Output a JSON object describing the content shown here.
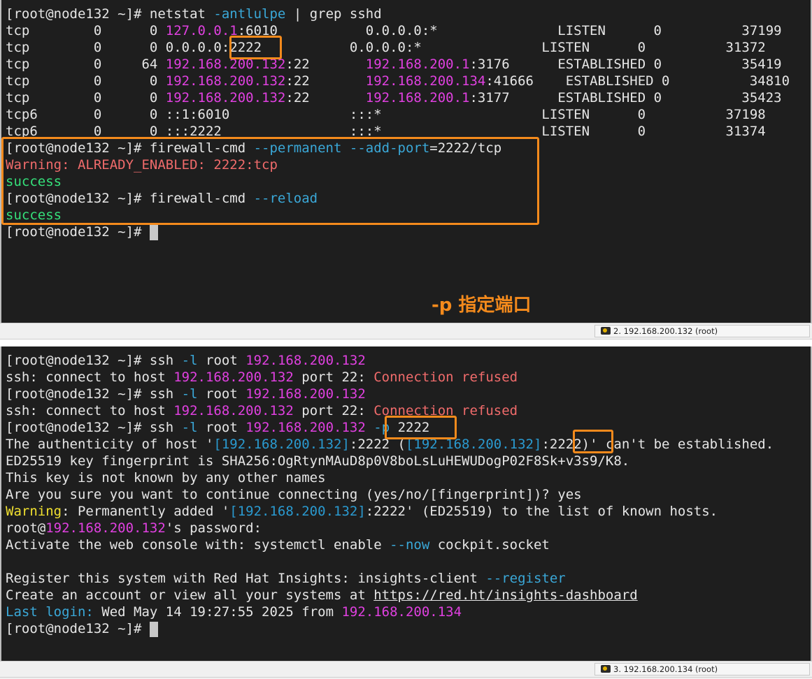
{
  "colors": {
    "background": "#1e1e1e",
    "text": "#e6e6e6",
    "magenta": "#e040e0",
    "cyan": "#3aa8d8",
    "red": "#f06b6b",
    "green": "#35e07a",
    "yellow": "#f0e030",
    "highlight": "#f48a1c"
  },
  "top_terminal": {
    "lines": [
      [
        [
          "white",
          "[root@node132 ~]# netstat "
        ],
        [
          "cyan",
          "-antlulpe"
        ],
        [
          "white",
          " | grep sshd"
        ]
      ],
      [
        [
          "white",
          "tcp        0      0 "
        ],
        [
          "magenta",
          "127.0.0.1"
        ],
        [
          "white",
          ":6010           0.0.0.0:*               LISTEN      0          37199"
        ]
      ],
      [
        [
          "white",
          "tcp        0      0 0.0.0.0:2222           0.0.0.0:*               LISTEN      0          31372"
        ]
      ],
      [
        [
          "white",
          "tcp        0     64 "
        ],
        [
          "magenta",
          "192.168.200.132"
        ],
        [
          "white",
          ":22       "
        ],
        [
          "magenta",
          "192.168.200.1"
        ],
        [
          "white",
          ":3176      ESTABLISHED 0          35419"
        ]
      ],
      [
        [
          "white",
          "tcp        0      0 "
        ],
        [
          "magenta",
          "192.168.200.132"
        ],
        [
          "white",
          ":22       "
        ],
        [
          "magenta",
          "192.168.200.134"
        ],
        [
          "white",
          ":41666    ESTABLISHED 0          34810"
        ]
      ],
      [
        [
          "white",
          "tcp        0      0 "
        ],
        [
          "magenta",
          "192.168.200.132"
        ],
        [
          "white",
          ":22       "
        ],
        [
          "magenta",
          "192.168.200.1"
        ],
        [
          "white",
          ":3177      ESTABLISHED 0          35423"
        ]
      ],
      [
        [
          "white",
          "tcp6       0      0 ::1:6010               :::*                    LISTEN      0          37198"
        ]
      ],
      [
        [
          "white",
          "tcp6       0      0 :::2222                :::*                    LISTEN      0          31374"
        ]
      ],
      [
        [
          "white",
          "[root@node132 ~]# firewall-cmd "
        ],
        [
          "cyan",
          "--permanent --add-port"
        ],
        [
          "white",
          "=2222/tcp"
        ]
      ],
      [
        [
          "red",
          "Warning: ALREADY_ENABLED: 2222:tcp"
        ]
      ],
      [
        [
          "green",
          "success"
        ]
      ],
      [
        [
          "white",
          "[root@node132 ~]# firewall-cmd "
        ],
        [
          "cyan",
          "--reload"
        ]
      ],
      [
        [
          "green",
          "success"
        ]
      ],
      [
        [
          "white",
          "[root@node132 ~]# "
        ]
      ]
    ],
    "annotation": "-p 指定端口",
    "status": "2. 192.168.200.132 (root)"
  },
  "bottom_terminal": {
    "lines": [
      [
        [
          "white",
          "[root@node132 ~]# ssh "
        ],
        [
          "cyan",
          "-l"
        ],
        [
          "white",
          " root "
        ],
        [
          "magenta",
          "192.168.200.132"
        ]
      ],
      [
        [
          "white",
          "ssh: connect to host "
        ],
        [
          "magenta",
          "192.168.200.132"
        ],
        [
          "white",
          " port 22: "
        ],
        [
          "red",
          "Connection refused"
        ]
      ],
      [
        [
          "white",
          "[root@node132 ~]# ssh "
        ],
        [
          "cyan",
          "-l"
        ],
        [
          "white",
          " root "
        ],
        [
          "magenta",
          "192.168.200.132"
        ]
      ],
      [
        [
          "white",
          "ssh: connect to host "
        ],
        [
          "magenta",
          "192.168.200.132"
        ],
        [
          "white",
          " port 22: "
        ],
        [
          "red",
          "Connection refused"
        ]
      ],
      [
        [
          "white",
          "[root@node132 ~]# ssh "
        ],
        [
          "cyan",
          "-l"
        ],
        [
          "white",
          " root "
        ],
        [
          "magenta",
          "192.168.200.132"
        ],
        [
          "white",
          " "
        ],
        [
          "cyan",
          "-p"
        ],
        [
          "white",
          " 2222"
        ]
      ],
      [
        [
          "white",
          "The authenticity of host '"
        ],
        [
          "blue",
          "[192.168.200.132]"
        ],
        [
          "white",
          ":2222 ("
        ],
        [
          "blue",
          "[192.168.200.132]"
        ],
        [
          "white",
          ":2222)' can't be established."
        ]
      ],
      [
        [
          "white",
          "ED25519 key fingerprint is SHA256:OgRtynMAuD8p0V8boLsLuHEWUDogP02F8Sk+v3s9/K8."
        ]
      ],
      [
        [
          "white",
          "This key is not known by any other names"
        ]
      ],
      [
        [
          "white",
          "Are you sure you want to continue connecting (yes/no/[fingerprint])? yes"
        ]
      ],
      [
        [
          "yellow",
          "Warning"
        ],
        [
          "white",
          ": Permanently added '"
        ],
        [
          "blue",
          "[192.168.200.132]"
        ],
        [
          "white",
          ":2222' (ED25519) to the list of known hosts."
        ]
      ],
      [
        [
          "white",
          "root@"
        ],
        [
          "magenta",
          "192.168.200.132"
        ],
        [
          "white",
          "'s password:"
        ]
      ],
      [
        [
          "white",
          "Activate the web console with: systemctl enable "
        ],
        [
          "cyan",
          "--now"
        ],
        [
          "white",
          " cockpit.socket"
        ]
      ],
      [
        [
          "white",
          ""
        ]
      ],
      [
        [
          "white",
          "Register this system with Red Hat Insights: insights-client "
        ],
        [
          "cyan",
          "--register"
        ]
      ],
      [
        [
          "white",
          "Create an account or view all your systems at "
        ],
        [
          "link",
          "https://red.ht/insights-dashboard"
        ]
      ],
      [
        [
          "cyan",
          "Last login:"
        ],
        [
          "white",
          " Wed May 14 19:27:55 2025 from "
        ],
        [
          "magenta",
          "192.168.200.134"
        ]
      ],
      [
        [
          "white",
          "[root@node132 ~]# "
        ]
      ]
    ],
    "status": "3. 192.168.200.134 (root)"
  }
}
